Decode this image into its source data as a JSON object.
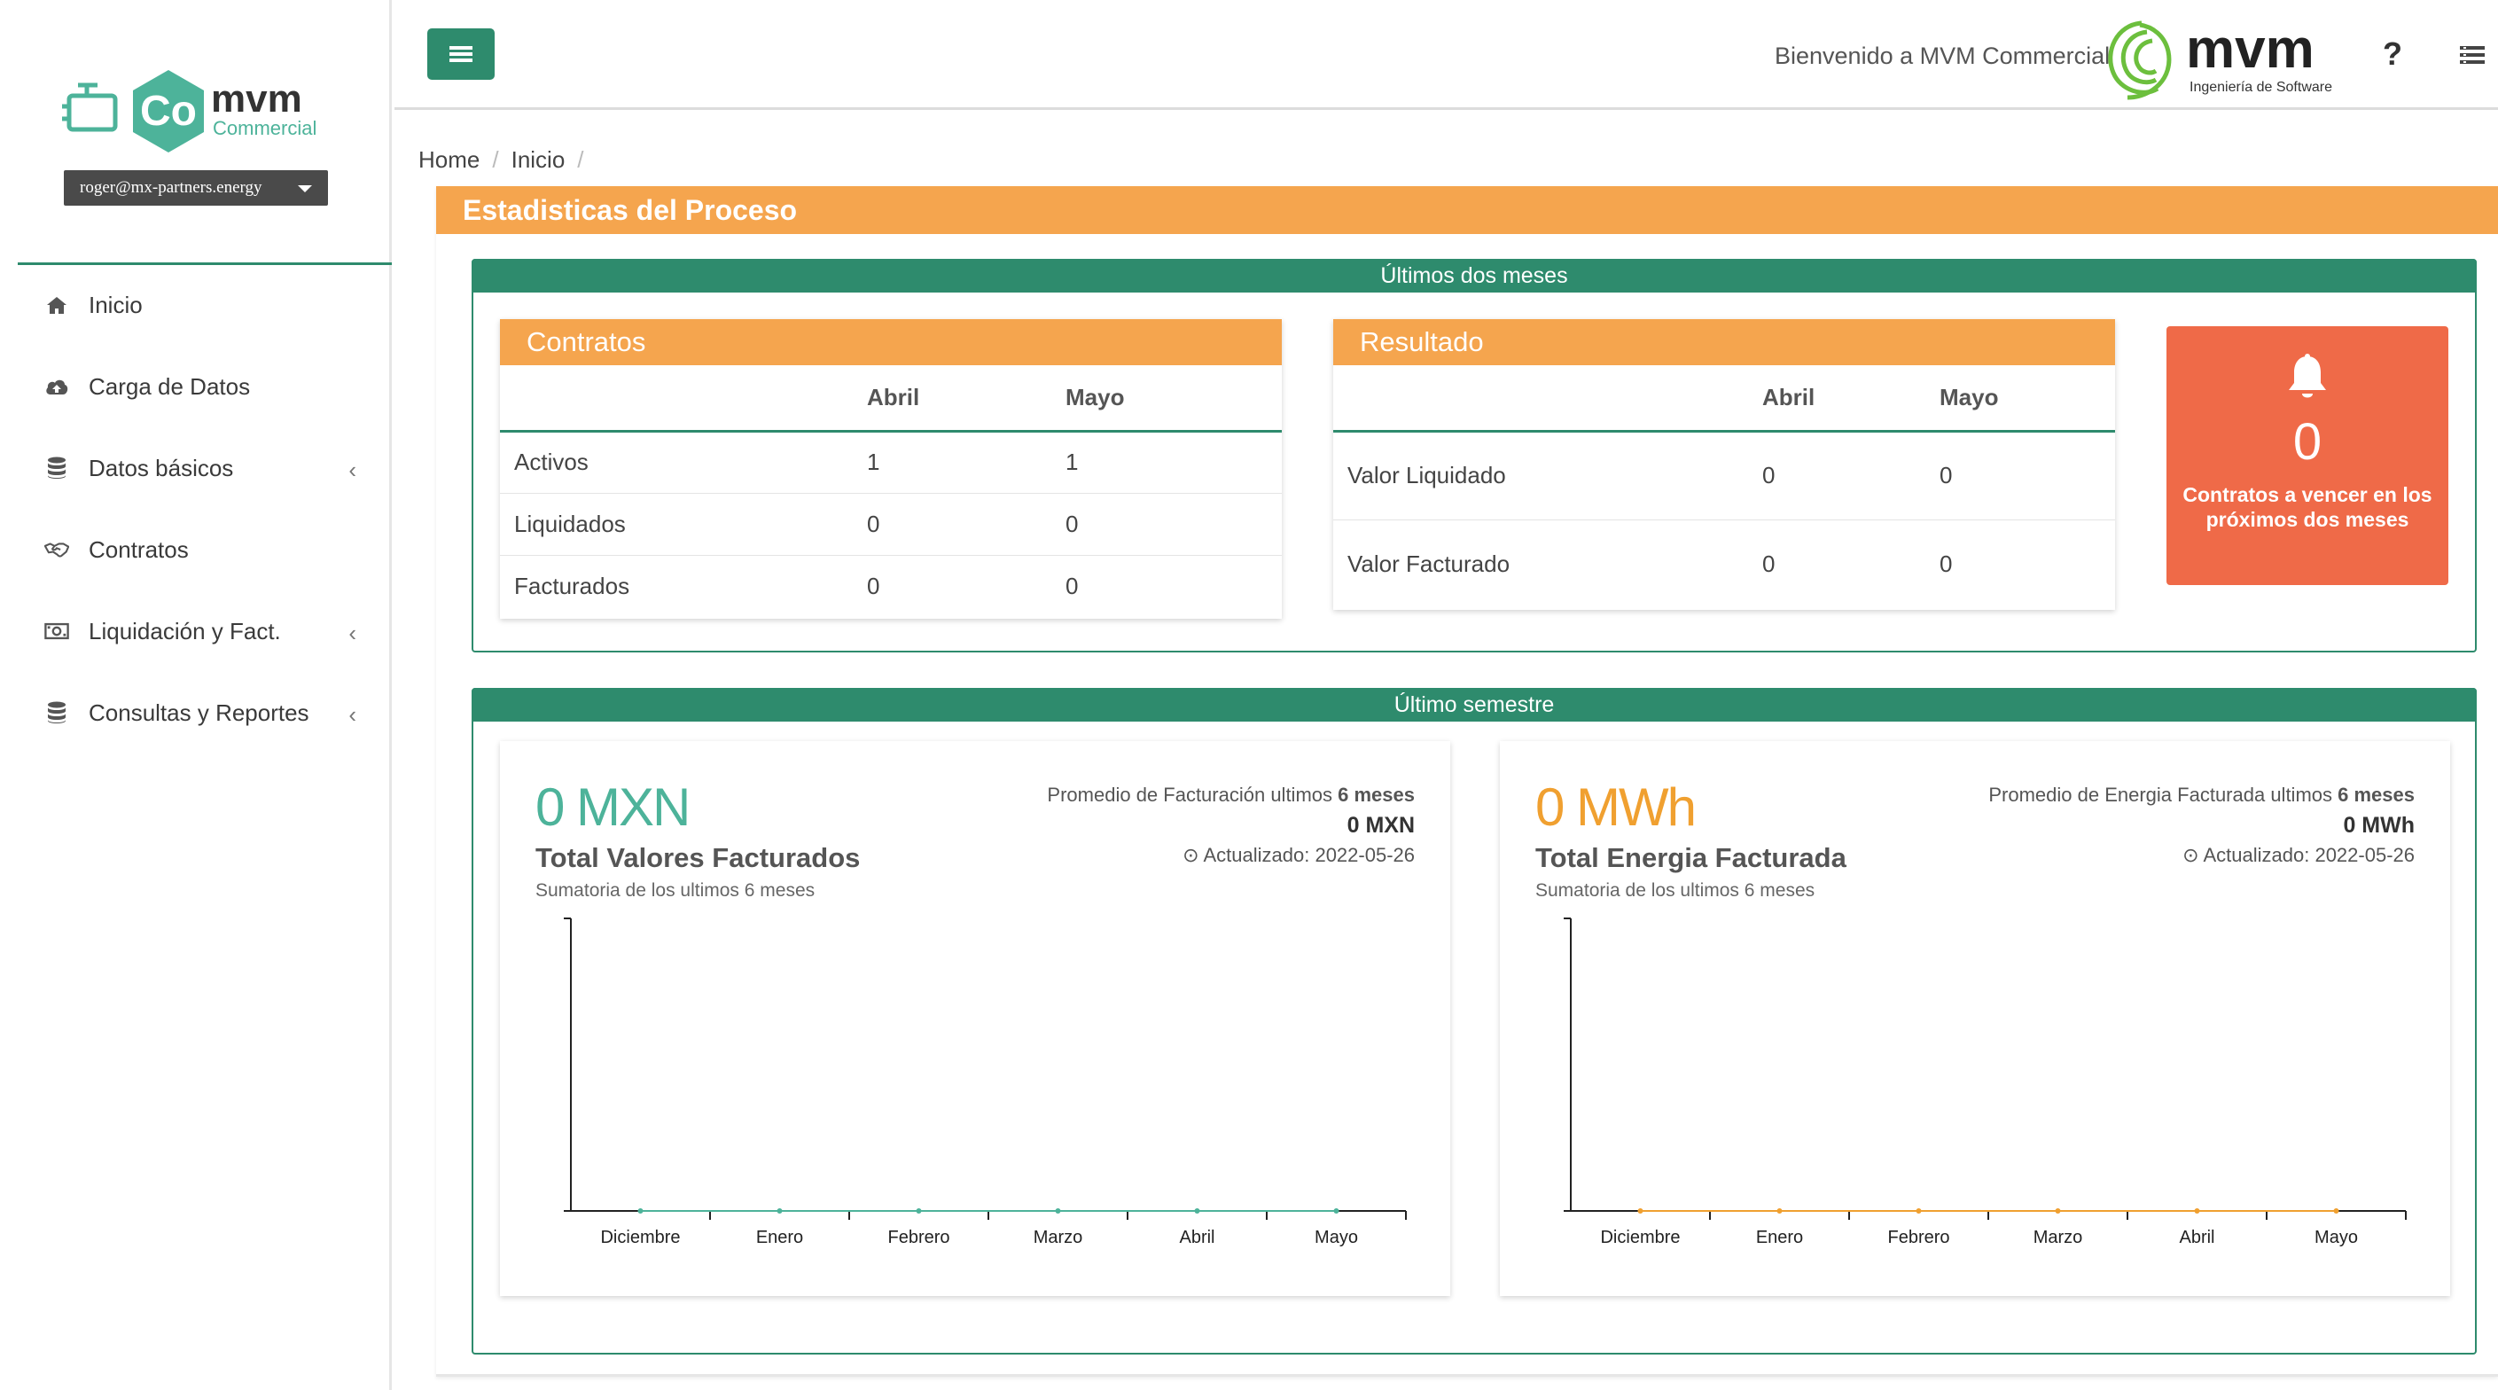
{
  "sidebar": {
    "logo": {
      "text": "mvm",
      "sub": "Commercial",
      "mark": "Co"
    },
    "user": "roger@mx-partners.energy",
    "items": [
      {
        "label": "Inicio",
        "icon": "home-icon",
        "has_children": false
      },
      {
        "label": "Carga de Datos",
        "icon": "cloud-upload-icon",
        "has_children": false
      },
      {
        "label": "Datos básicos",
        "icon": "database-icon",
        "has_children": true
      },
      {
        "label": "Contratos",
        "icon": "handshake-icon",
        "has_children": false
      },
      {
        "label": "Liquidación y Fact.",
        "icon": "money-icon",
        "has_children": true
      },
      {
        "label": "Consultas y Reportes",
        "icon": "database-icon",
        "has_children": true
      }
    ]
  },
  "topbar": {
    "welcome": "Bienvenido a MVM Commercial",
    "brand": "mvm",
    "brand_sub": "Ingeniería de Software",
    "help": "?"
  },
  "breadcrumb": [
    "Home",
    "Inicio"
  ],
  "main": {
    "title": "Estadisticas del Proceso",
    "recent": {
      "title": "Últimos dos meses",
      "contratos": {
        "title": "Contratos",
        "columns": [
          "",
          "Abril",
          "Mayo"
        ],
        "rows": [
          {
            "label": "Activos",
            "abril": "1",
            "mayo": "1"
          },
          {
            "label": "Liquidados",
            "abril": "0",
            "mayo": "0"
          },
          {
            "label": "Facturados",
            "abril": "0",
            "mayo": "0"
          }
        ]
      },
      "resultado": {
        "title": "Resultado",
        "columns": [
          "",
          "Abril",
          "Mayo"
        ],
        "rows": [
          {
            "label": "Valor Liquidado",
            "abril": "0",
            "mayo": "0"
          },
          {
            "label": "Valor Facturado",
            "abril": "0",
            "mayo": "0"
          }
        ]
      },
      "alert": {
        "count": "0",
        "text": "Contratos a vencer en los próximos dos meses"
      }
    },
    "semester": {
      "title": "Último semestre",
      "facturados": {
        "big_value": "0 MXN",
        "title": "Total Valores Facturados",
        "subtitle": "Sumatoria de los ultimos 6 meses",
        "avg_label": "Promedio de Facturación ultimos",
        "avg_period": "6 meses",
        "avg_value": "0 MXN",
        "updated": "Actualizado: 2022-05-26",
        "color": "#4db39a"
      },
      "energia": {
        "big_value": "0 MWh",
        "title": "Total Energia Facturada",
        "subtitle": "Sumatoria de los ultimos 6 meses",
        "avg_label": "Promedio de Energia Facturada ultimos",
        "avg_period": "6 meses",
        "avg_value": "0 MWh",
        "updated": "Actualizado: 2022-05-26",
        "color": "#f0a030"
      }
    }
  },
  "chart_data": [
    {
      "type": "line",
      "categories": [
        "Diciembre",
        "Enero",
        "Febrero",
        "Marzo",
        "Abril",
        "Mayo"
      ],
      "series": [
        {
          "values": [
            0,
            0,
            0,
            0,
            0,
            0
          ]
        }
      ],
      "color": "#4db39a"
    },
    {
      "type": "line",
      "categories": [
        "Diciembre",
        "Enero",
        "Febrero",
        "Marzo",
        "Abril",
        "Mayo"
      ],
      "series": [
        {
          "values": [
            0,
            0,
            0,
            0,
            0,
            0
          ]
        }
      ],
      "color": "#f0a030"
    }
  ],
  "colors": {
    "primary": "#2e8b6d",
    "accent": "#f5a54e",
    "alert": "#ef6a48"
  }
}
